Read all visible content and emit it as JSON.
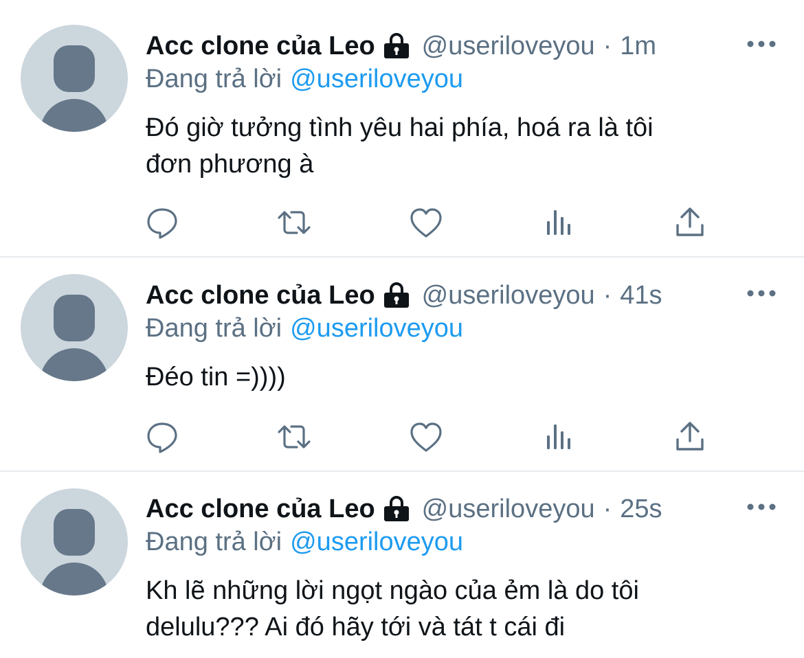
{
  "tweets": [
    {
      "name": "Acc clone của Leo",
      "handle": "@useriloveyou",
      "separator": "·",
      "time": "1m",
      "reply_prefix": "Đang trả lời",
      "reply_to": "@useriloveyou",
      "text_lines": [
        "Đó giờ tưởng tình yêu hai phía, hoá ra là tôi",
        "đơn phương à"
      ]
    },
    {
      "name": "Acc clone của Leo",
      "handle": "@useriloveyou",
      "separator": "·",
      "time": "41s",
      "reply_prefix": "Đang trả lời",
      "reply_to": "@useriloveyou",
      "text_lines": [
        "Đéo tin =))))"
      ]
    },
    {
      "name": "Acc clone của Leo",
      "handle": "@useriloveyou",
      "separator": "·",
      "time": "25s",
      "reply_prefix": "Đang trả lời",
      "reply_to": "@useriloveyou",
      "text_lines": [
        "Kh lẽ những lời ngọt ngào của ẻm là do tôi",
        "delulu??? Ai đó hãy tới và tát t cái đi"
      ]
    }
  ],
  "icons": {
    "lock": "lock-icon",
    "more": "more-icon",
    "reply": "reply-icon",
    "retweet": "retweet-icon",
    "like": "heart-icon",
    "stats": "stats-icon",
    "share": "share-icon"
  },
  "colors": {
    "name": "#0f1419",
    "secondary": "#5b7083",
    "mention": "#1d9bf0",
    "avatar_bg": "#ccd6dd",
    "avatar_fg": "#66788a",
    "divider": "#e6eaed"
  }
}
